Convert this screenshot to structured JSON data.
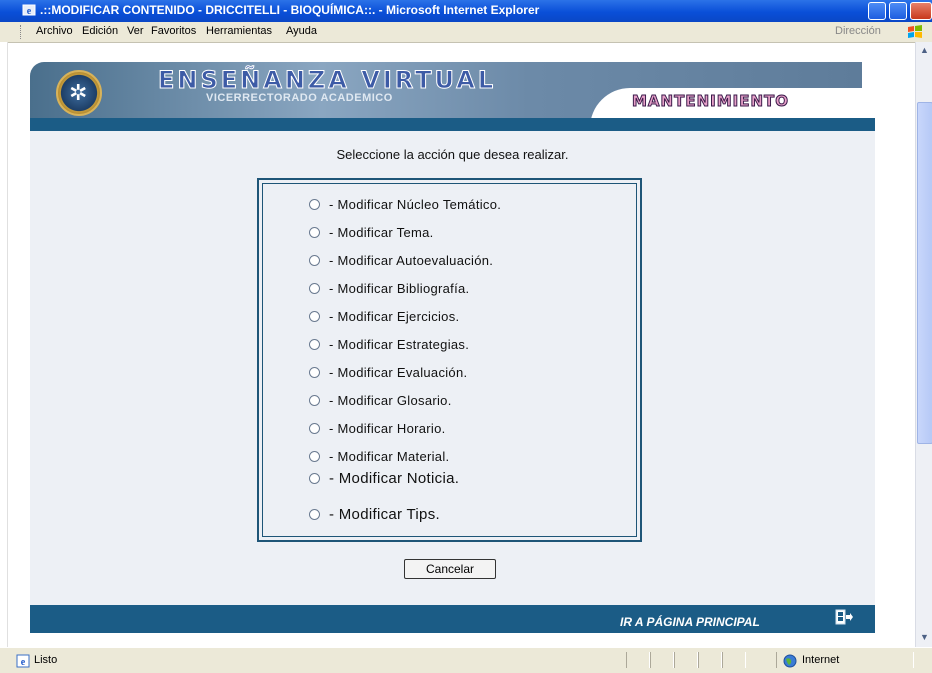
{
  "window": {
    "title": ".::MODIFICAR CONTENIDO - DRICCITELLI - BIOQUÍMICA::. - Microsoft Internet Explorer"
  },
  "menubar": {
    "items": [
      "Archivo",
      "Edición",
      "Ver",
      "Favoritos",
      "Herramientas",
      "Ayuda"
    ],
    "address_label": "Dirección"
  },
  "banner": {
    "title": "ENSEÑANZA VIRTUAL",
    "subtitle": "VICERRECTORADO ACADEMICO",
    "section": "MANTENIMIENTO"
  },
  "main": {
    "prompt": "Seleccione la acción que desea realizar.",
    "options": [
      "- Modificar Núcleo Temático.",
      "- Modificar Tema.",
      "- Modificar Autoevaluación.",
      "- Modificar Bibliografía.",
      "- Modificar Ejercicios.",
      "- Modificar Estrategias.",
      "- Modificar Evaluación.",
      "- Modificar Glosario.",
      "- Modificar Horario.",
      "- Modificar Material.",
      "- Modificar Noticia.",
      "- Modificar Tips."
    ],
    "cancel_label": "Cancelar"
  },
  "footer": {
    "link": "IR A PÁGINA PRINCIPAL"
  },
  "statusbar": {
    "status": "Listo",
    "zone": "Internet"
  },
  "colors": {
    "titlebar": "#0a4fd8",
    "bar": "#1b5c86",
    "content_bg": "#edf0f5",
    "chrome": "#ece9d8"
  }
}
